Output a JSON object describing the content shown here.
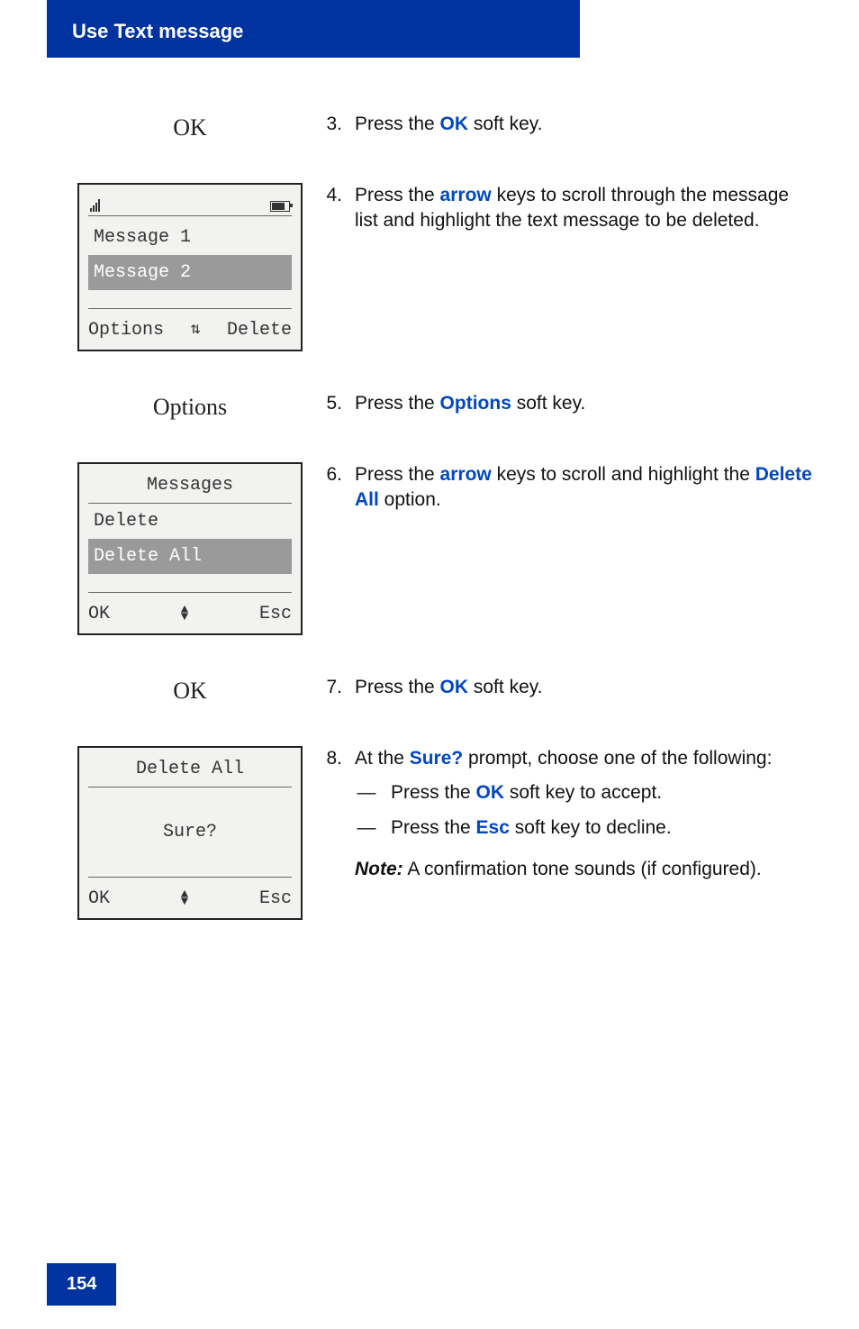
{
  "header": {
    "title": "Use Text message"
  },
  "labels": {
    "ok": "OK",
    "options": "Options"
  },
  "phone1": {
    "items": [
      "Message 1",
      "Message 2"
    ],
    "selected_index": 1,
    "soft_left": "Options",
    "soft_right": "Delete"
  },
  "phone2": {
    "title": "Messages",
    "items": [
      "Delete",
      "Delete All"
    ],
    "selected_index": 1,
    "soft_left": "OK",
    "soft_right": "Esc"
  },
  "phone3": {
    "title": "Delete All",
    "prompt": "Sure?",
    "soft_left": "OK",
    "soft_right": "Esc"
  },
  "steps": {
    "s3": {
      "n": "3.",
      "pre": "Press the ",
      "kw": "OK",
      "post": " soft key."
    },
    "s4": {
      "n": "4.",
      "pre": "Press the ",
      "kw": "arrow",
      "post": " keys to scroll through the message list and highlight the text message to be deleted."
    },
    "s5": {
      "n": "5.",
      "pre": "Press the ",
      "kw": "Options",
      "post": " soft key."
    },
    "s6": {
      "n": "6.",
      "pre": "Press the ",
      "kw": "arrow",
      "mid": " keys to scroll and highlight the ",
      "kw2": "Delete All",
      "post": " option."
    },
    "s7": {
      "n": "7.",
      "pre": "Press the ",
      "kw": "OK",
      "post": " soft key."
    },
    "s8": {
      "n": "8.",
      "pre": "At the ",
      "kw": "Sure?",
      "post": " prompt, choose one of the following:",
      "opt1": {
        "pre": "Press the ",
        "kw": "OK",
        "post": " soft key to accept."
      },
      "opt2": {
        "pre": "Press the ",
        "kw": "Esc",
        "post": " soft key to decline."
      },
      "note_label": "Note:",
      "note_text": " A confirmation tone sounds (if configured)."
    }
  },
  "footer": {
    "page_number": "154"
  }
}
